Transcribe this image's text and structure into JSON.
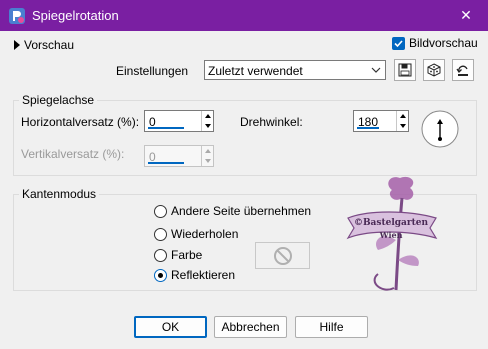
{
  "window": {
    "title": "Spiegelrotation",
    "close_glyph": "✕",
    "accent": "#7a1fa2"
  },
  "top": {
    "preview_label": "Vorschau",
    "bildvorschau_label": "Bildvorschau",
    "bildvorschau_checked": true,
    "settings_label": "Einstellungen",
    "settings_value": "Zuletzt verwendet"
  },
  "spiegelachse": {
    "title": "Spiegelachse",
    "horiz_label": "Horizontalversatz (%):",
    "horiz_value": "0",
    "vert_label": "Vertikalversatz (%):",
    "vert_value": "0",
    "angle_label": "Drehwinkel:",
    "angle_value": "180"
  },
  "kantenmodus": {
    "title": "Kantenmodus",
    "options": [
      "Andere Seite übernehmen",
      "Wiederholen",
      "Farbe",
      "Reflektieren"
    ],
    "selected": "Reflektieren"
  },
  "watermark": {
    "line1": "©Bastelgarten",
    "line2": "Wien"
  },
  "buttons": {
    "ok": "OK",
    "cancel": "Abbrechen",
    "help": "Hilfe"
  }
}
